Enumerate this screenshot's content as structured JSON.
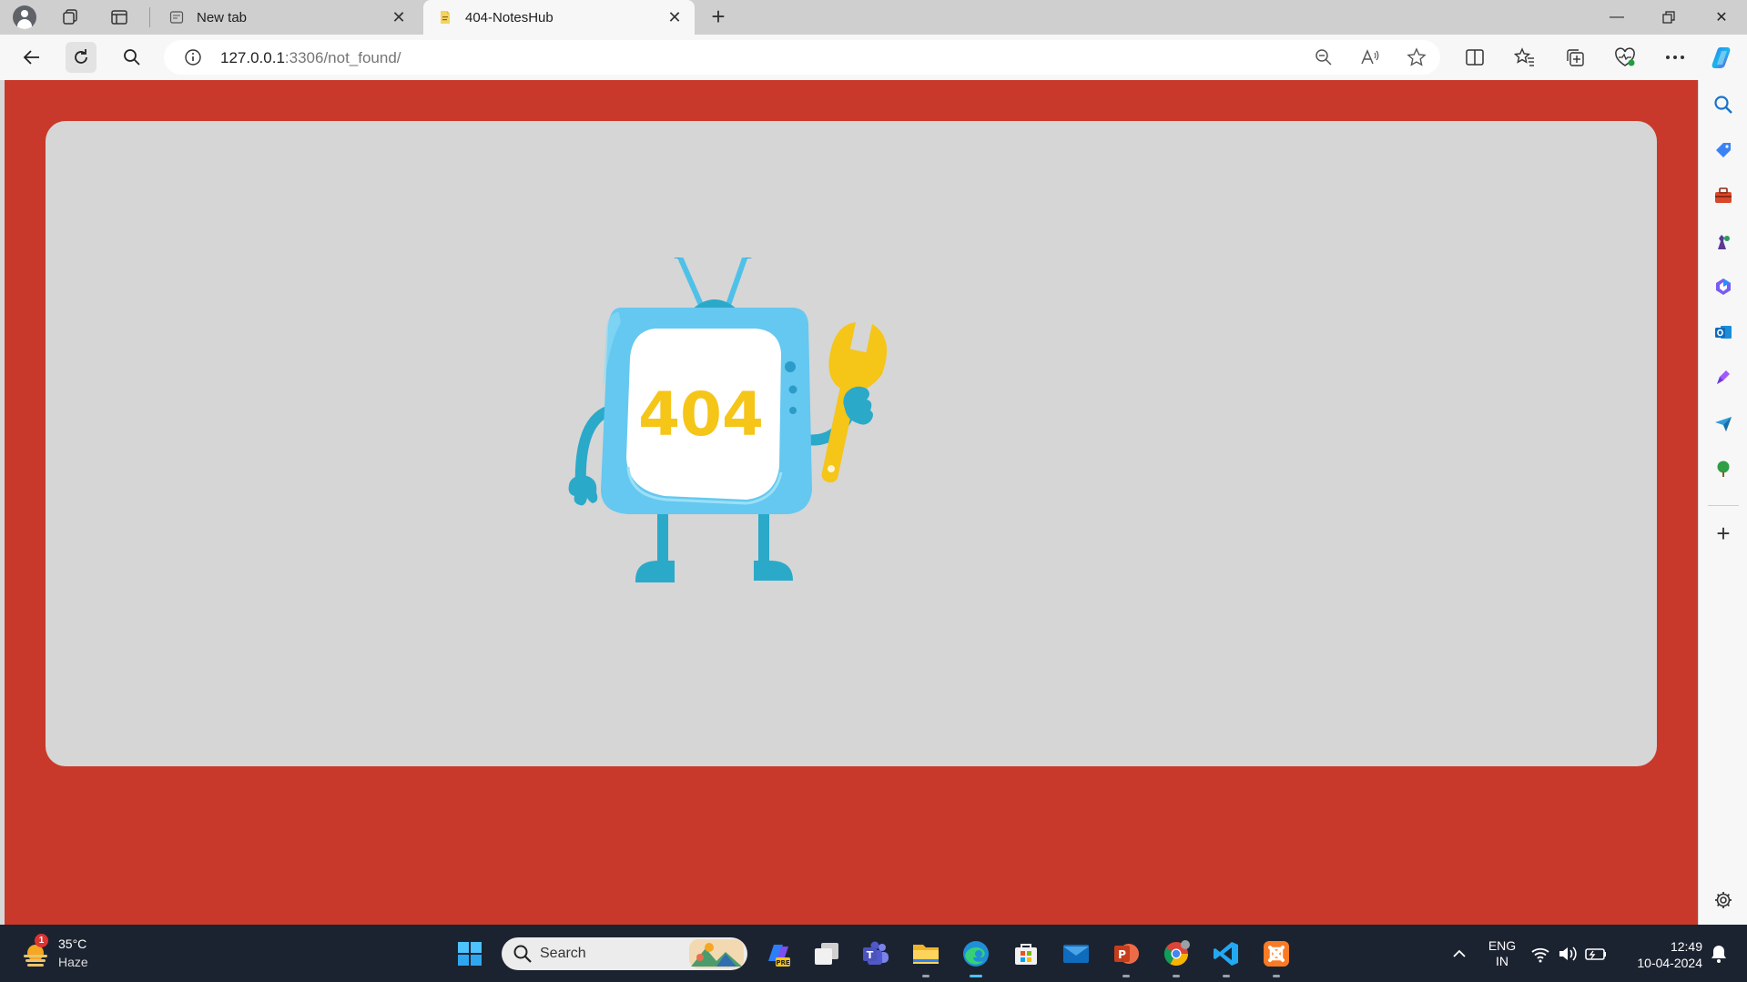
{
  "browser": {
    "tabs": [
      {
        "title": "New tab",
        "active": false
      },
      {
        "title": "404-NotesHub",
        "active": true
      }
    ],
    "address": {
      "host": "127.0.0.1",
      "rest": ":3306/not_found/"
    }
  },
  "page": {
    "background_color": "#c9392b",
    "card_color": "#d6d6d6",
    "illustration_text": "404"
  },
  "taskbar": {
    "weather": {
      "temp": "35°C",
      "desc": "Haze",
      "badge": "1"
    },
    "search_label": "Search",
    "language": {
      "line1": "ENG",
      "line2": "IN"
    },
    "clock": {
      "time": "12:49",
      "date": "10-04-2024"
    }
  }
}
